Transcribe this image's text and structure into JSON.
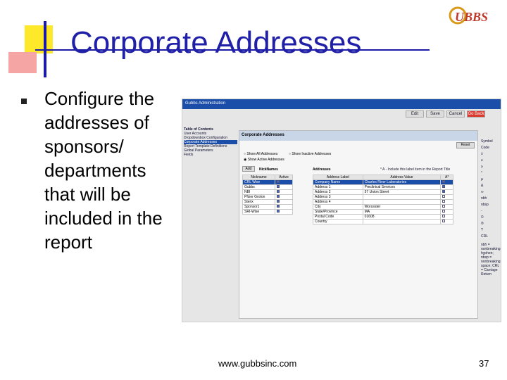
{
  "slide": {
    "title": "Corporate Addresses",
    "bullet": "Configure the addresses of sponsors/ departments that will be included in the report",
    "footer_url": "www.gubbsinc.com",
    "page_number": "37",
    "logo_text": "GUBBS"
  },
  "screenshot": {
    "window_title": "Gubbs Administration",
    "toolbar": [
      "Edit",
      "Save",
      "Cancel",
      "Go Back"
    ],
    "toc_header": "Table of Contents",
    "toc_items": [
      "User Accounts",
      "Dropdownbox Configuration",
      "Corporate Addresses",
      "Report Template Definitions",
      "Global Parameters",
      "Fields"
    ],
    "panel_title": "Corporate Addresses",
    "reset_label": "Reset",
    "radio_all": "Show All Addresses",
    "radio_active": "Show Active Addresses",
    "radio_inactive": "Show Inactive Addresses",
    "add_label": "Add",
    "nicknames_label": "NickNames",
    "addresses_label": "Addresses",
    "note": "* A - Include this label item in the Report Title",
    "nick_cols": [
      "Nickname",
      "Active"
    ],
    "nicknames": [
      "CRL Wise",
      "Gubbs",
      "NBI",
      "Pfizer Groton",
      "Sterix",
      "Sponsor1",
      "SRI-Wise"
    ],
    "addr_cols": [
      "Address Label",
      "Address Value",
      "A*"
    ],
    "addresses": [
      [
        "Company Name",
        "Charles River Laboratories"
      ],
      [
        "Address 1",
        "Preclinical Services"
      ],
      [
        "Address 2",
        "57 Union Street"
      ],
      [
        "Address 3",
        ""
      ],
      [
        "Address 4",
        ""
      ],
      [
        "City",
        "Worcester"
      ],
      [
        "State/Province",
        "MA"
      ],
      [
        "Postal Code",
        "01608"
      ],
      [
        "Country",
        ""
      ]
    ],
    "side_header": "Symbol Code",
    "side_items": [
      "±",
      "≤",
      "≥",
      "°",
      "µ",
      "&",
      "∞",
      "nbh",
      "nbsp",
      "-",
      "©",
      "®",
      "?",
      "CRL"
    ],
    "side_notes": "nbh = nonbreaking hyphen; nbsp = nonbreaking space; CRL = Carriage Return"
  },
  "colors": {
    "title": "#1f1fa8",
    "accent_blue": "#1b4ea8",
    "deco_yellow": "#fde92a",
    "deco_pink": "#f6a5a5"
  }
}
